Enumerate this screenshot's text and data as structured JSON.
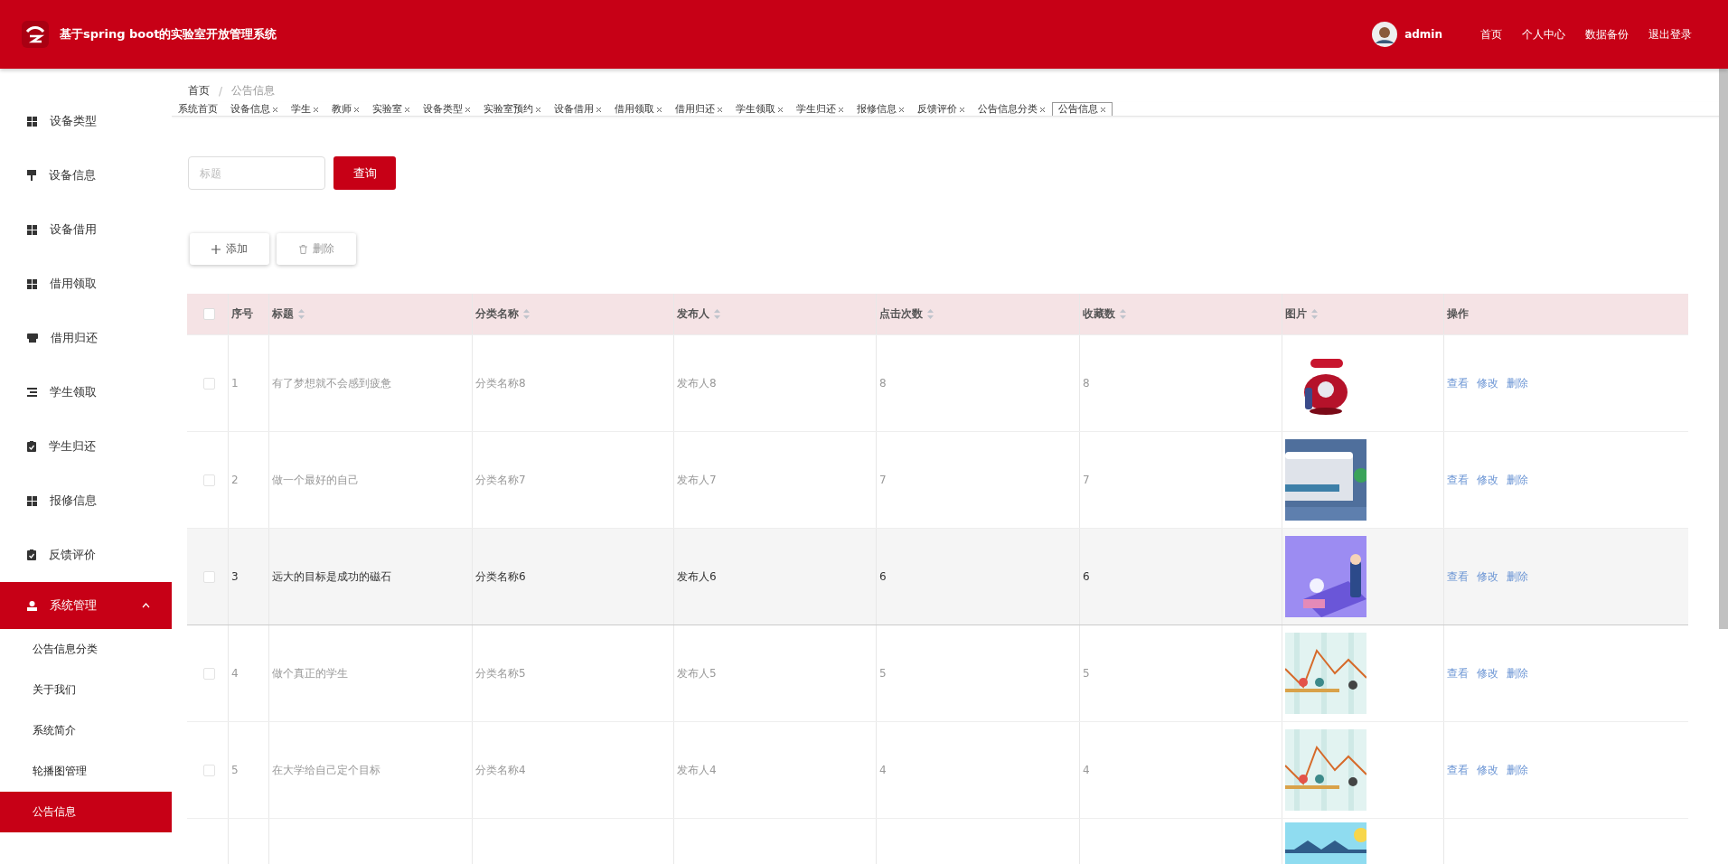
{
  "header": {
    "title": "基于spring boot的实验室开放管理系统",
    "user": "admin",
    "links": [
      "首页",
      "个人中心",
      "数据备份",
      "退出登录"
    ]
  },
  "sidebar": {
    "items": [
      {
        "label": "设备类型",
        "selected": false
      },
      {
        "label": "设备信息",
        "selected": false
      },
      {
        "label": "设备借用",
        "selected": false
      },
      {
        "label": "借用领取",
        "selected": false
      },
      {
        "label": "借用归还",
        "selected": false
      },
      {
        "label": "学生领取",
        "selected": false
      },
      {
        "label": "学生归还",
        "selected": false
      },
      {
        "label": "报修信息",
        "selected": false
      },
      {
        "label": "反馈评价",
        "selected": false
      },
      {
        "label": "系统管理",
        "selected": true,
        "expanded": true,
        "children": [
          {
            "label": "公告信息分类",
            "selected": false
          },
          {
            "label": "关于我们",
            "selected": false
          },
          {
            "label": "系统简介",
            "selected": false
          },
          {
            "label": "轮播图管理",
            "selected": false
          },
          {
            "label": "公告信息",
            "selected": true
          }
        ]
      }
    ]
  },
  "breadcrumb": {
    "separator": "/",
    "items": [
      "首页",
      "公告信息"
    ]
  },
  "tabs": [
    {
      "label": "系统首页",
      "closable": false,
      "selected": false
    },
    {
      "label": "设备信息",
      "closable": true,
      "selected": false
    },
    {
      "label": "学生",
      "closable": true,
      "selected": false
    },
    {
      "label": "教师",
      "closable": true,
      "selected": false
    },
    {
      "label": "实验室",
      "closable": true,
      "selected": false
    },
    {
      "label": "设备类型",
      "closable": true,
      "selected": false
    },
    {
      "label": "实验室预约",
      "closable": true,
      "selected": false
    },
    {
      "label": "设备借用",
      "closable": true,
      "selected": false
    },
    {
      "label": "借用领取",
      "closable": true,
      "selected": false
    },
    {
      "label": "借用归还",
      "closable": true,
      "selected": false
    },
    {
      "label": "学生领取",
      "closable": true,
      "selected": false
    },
    {
      "label": "学生归还",
      "closable": true,
      "selected": false
    },
    {
      "label": "报修信息",
      "closable": true,
      "selected": false
    },
    {
      "label": "反馈评价",
      "closable": true,
      "selected": false
    },
    {
      "label": "公告信息分类",
      "closable": true,
      "selected": false
    },
    {
      "label": "公告信息",
      "closable": true,
      "selected": true
    }
  ],
  "search": {
    "placeholder": "标题",
    "button": "查询"
  },
  "actions": {
    "add": "添加",
    "delete": "删除"
  },
  "table": {
    "select_all": {
      "checked": false
    },
    "columns": [
      {
        "label": "序号",
        "sortable": false
      },
      {
        "label": "标题",
        "sortable": true
      },
      {
        "label": "分类名称",
        "sortable": true
      },
      {
        "label": "发布人",
        "sortable": true
      },
      {
        "label": "点击次数",
        "sortable": true
      },
      {
        "label": "收藏数",
        "sortable": true
      },
      {
        "label": "图片",
        "sortable": true
      },
      {
        "label": "操作",
        "sortable": false
      }
    ],
    "rows": [
      {
        "checked": false,
        "highlighted": false,
        "cells": [
          "1",
          "有了梦想就不会感到疲惫",
          "分类名称8",
          "发布人8",
          "8",
          "8"
        ],
        "picture": {
          "kind": "picture"
        },
        "ops": [
          "查看",
          "修改",
          "删除"
        ]
      },
      {
        "checked": false,
        "highlighted": false,
        "cells": [
          "2",
          "做一个最好的自己",
          "分类名称7",
          "发布人7",
          "7",
          "7"
        ],
        "picture": {
          "kind": "picture"
        },
        "ops": [
          "查看",
          "修改",
          "删除"
        ]
      },
      {
        "checked": false,
        "highlighted": true,
        "cells": [
          "3",
          "远大的目标是成功的磁石",
          "分类名称6",
          "发布人6",
          "6",
          "6"
        ],
        "picture": {
          "kind": "picture"
        },
        "ops": [
          "查看",
          "修改",
          "删除"
        ]
      },
      {
        "checked": false,
        "highlighted": false,
        "cells": [
          "4",
          "做个真正的学生",
          "分类名称5",
          "发布人5",
          "5",
          "5"
        ],
        "picture": {
          "kind": "picture"
        },
        "ops": [
          "查看",
          "修改",
          "删除"
        ]
      },
      {
        "checked": false,
        "highlighted": false,
        "cells": [
          "5",
          "在大学给自己定个目标",
          "分类名称4",
          "发布人4",
          "4",
          "4"
        ],
        "picture": {
          "kind": "picture"
        },
        "ops": [
          "查看",
          "修改",
          "删除"
        ]
      },
      {
        "cells": [],
        "picture": {
          "kind": "picture"
        },
        "ops": []
      }
    ]
  }
}
